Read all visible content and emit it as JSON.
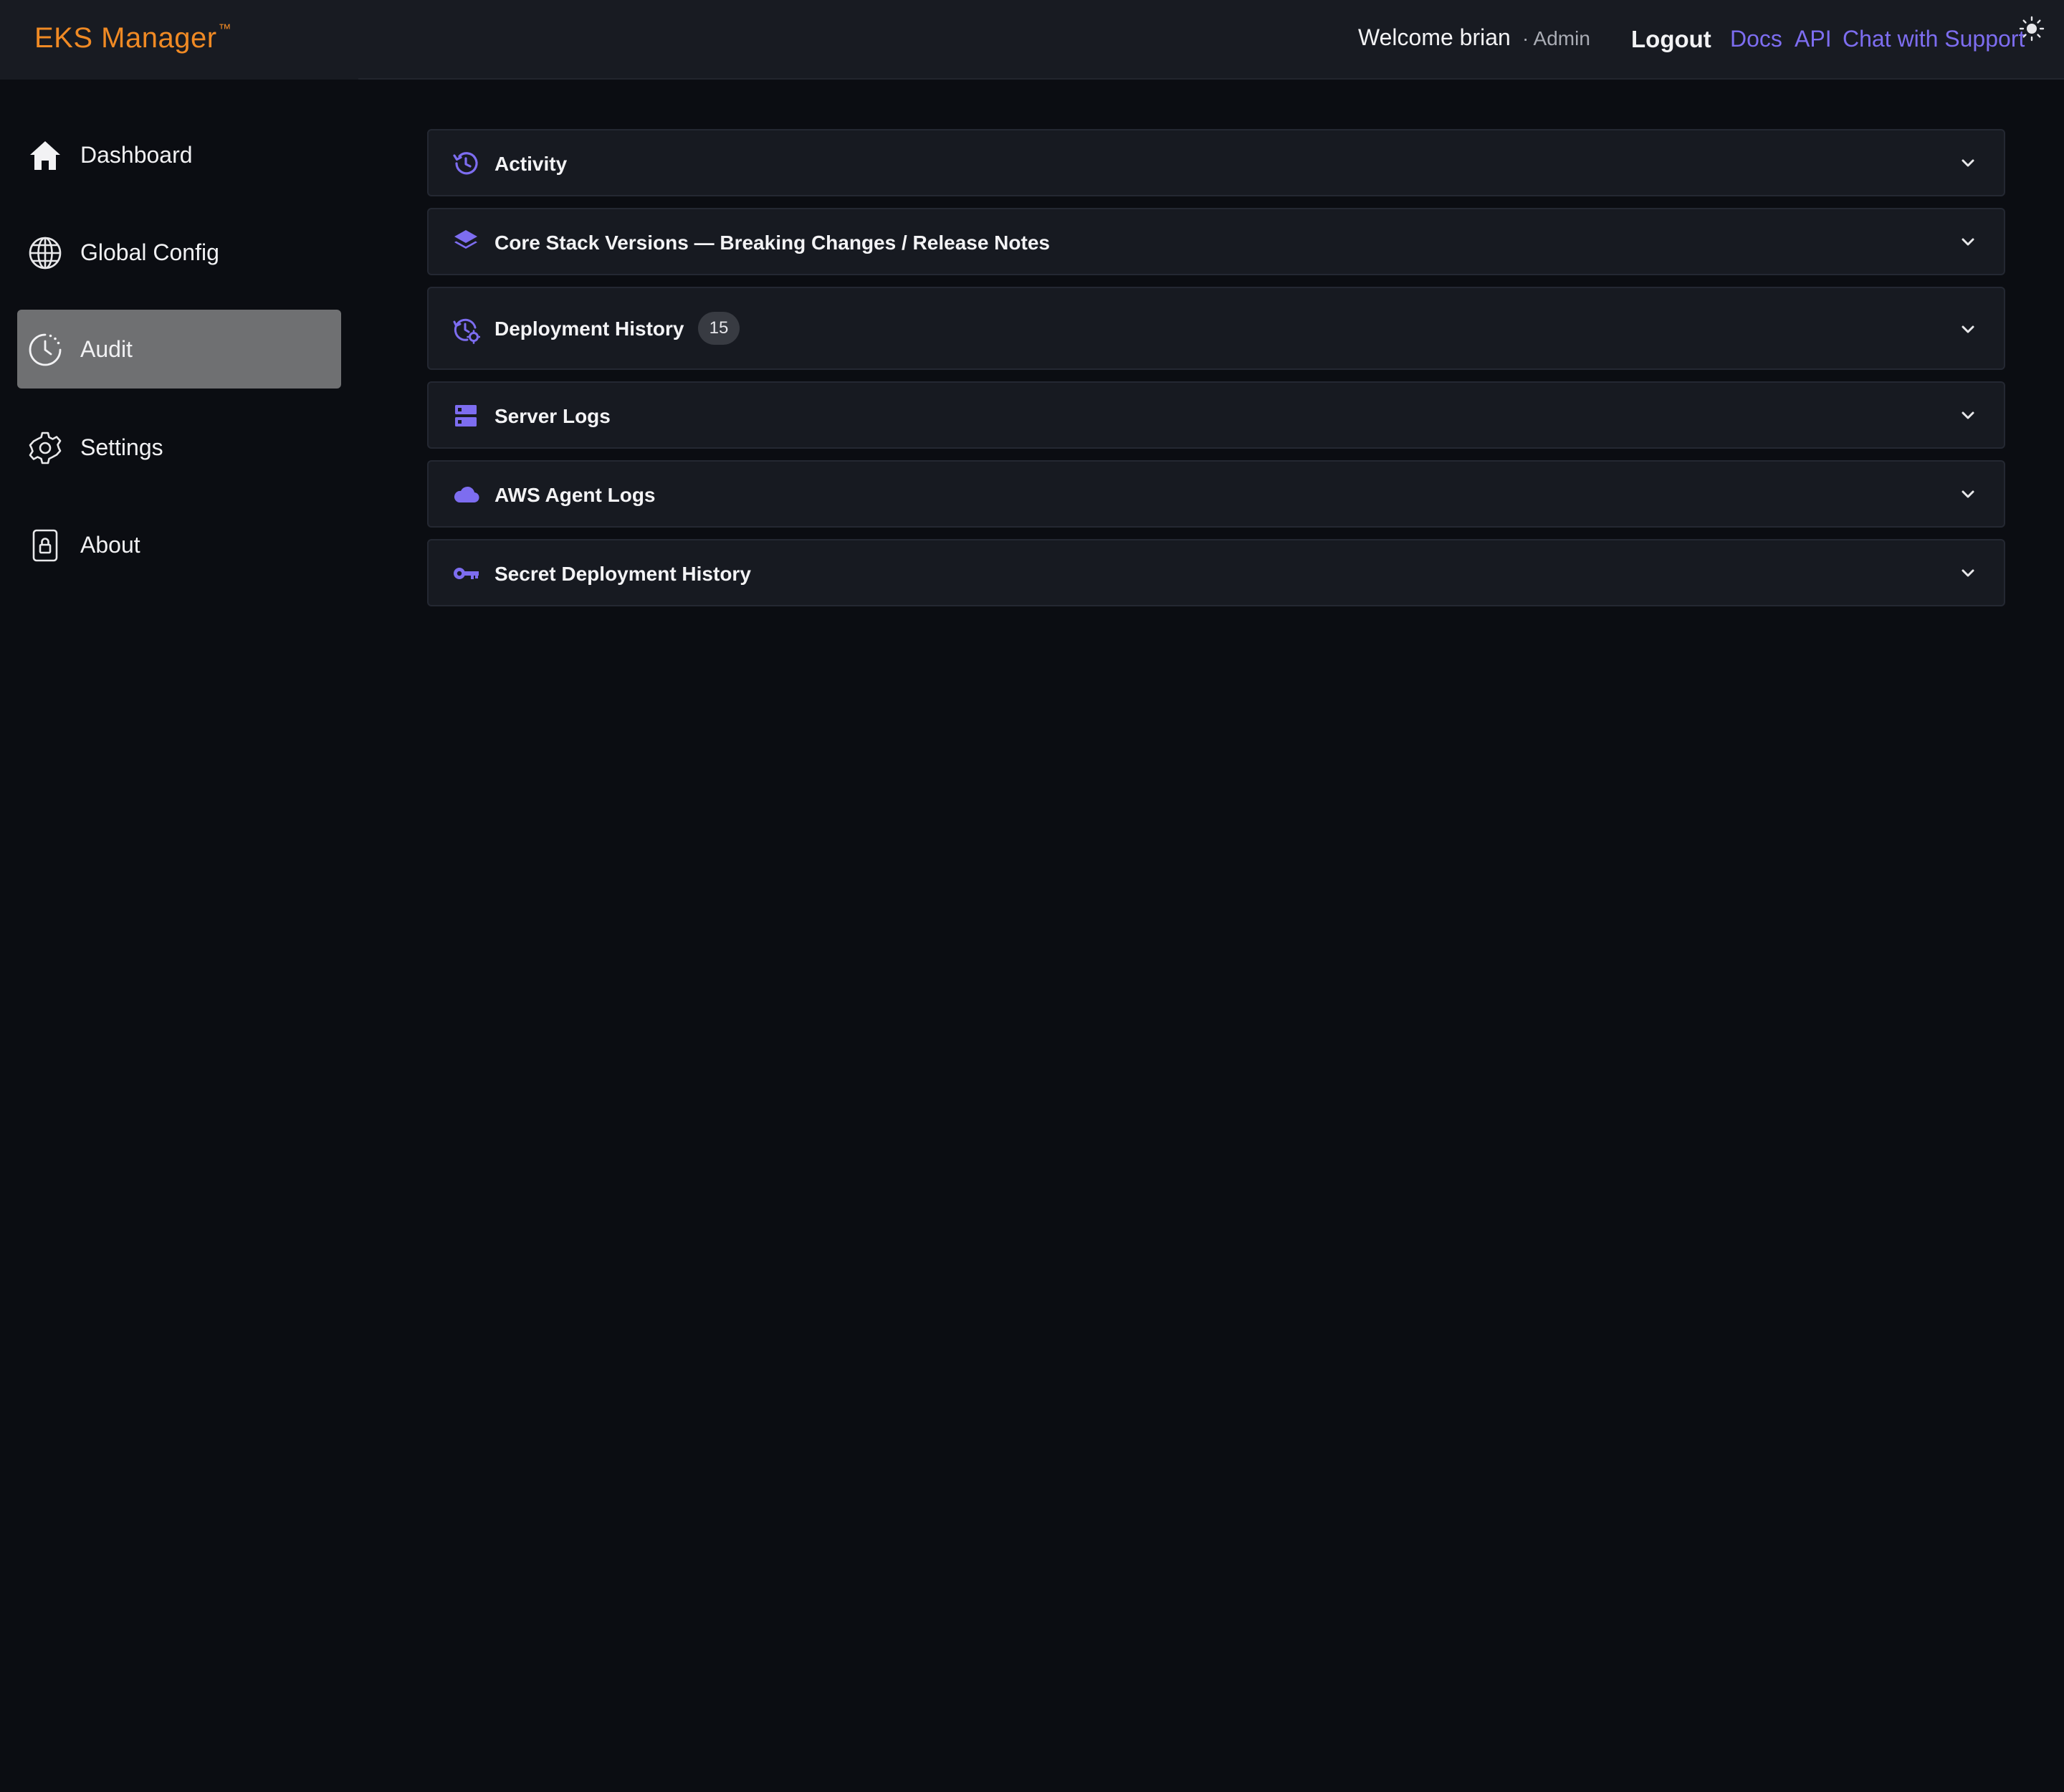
{
  "header": {
    "brand": "EKS Manager",
    "brand_mark": "™",
    "welcome": "Welcome brian",
    "role": "· Admin",
    "logout_label": "Logout",
    "links": [
      "Docs",
      "API",
      "Chat with Support"
    ],
    "theme_icon": "sun-icon"
  },
  "sidebar": {
    "items": [
      {
        "label": "Dashboard",
        "icon": "home-icon"
      },
      {
        "label": "Global Config",
        "icon": "globe-icon"
      },
      {
        "label": "Audit",
        "icon": "clock-icon",
        "active": true
      },
      {
        "label": "Settings",
        "icon": "gear-icon"
      },
      {
        "label": "About",
        "icon": "lock-icon"
      }
    ]
  },
  "main": {
    "panels": [
      {
        "title": "Activity",
        "icon": "history-icon"
      },
      {
        "title": "Core Stack Versions — Breaking Changes / Release Notes",
        "icon": "layers-icon"
      },
      {
        "title": "Deployment History",
        "icon": "history-gear-icon",
        "badge": "15"
      },
      {
        "title": "Server Logs",
        "icon": "server-icon"
      },
      {
        "title": "AWS Agent Logs",
        "icon": "cloud-icon"
      },
      {
        "title": "Secret Deployment History",
        "icon": "key-icon"
      }
    ]
  },
  "colors": {
    "accent": "#7d6df0",
    "brand": "#f08a24",
    "background": "#0b0d12",
    "panel": "#171a21",
    "active_nav": "#6f7072"
  }
}
